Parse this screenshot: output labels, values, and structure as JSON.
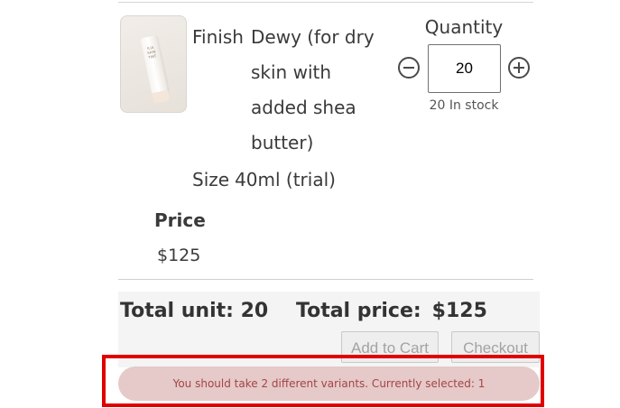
{
  "product": {
    "image_alt": "tube-icon",
    "tube_text": "ILIA SKIN TINT",
    "variant_label": "Finish",
    "variant_value": "Dewy (for dry skin with added shea butter)",
    "size_label": "Size",
    "size_value": "40ml (trial)"
  },
  "quantity": {
    "heading": "Quantity",
    "value": "20",
    "stock_note": "20 In stock"
  },
  "price": {
    "heading": "Price",
    "value": "$125"
  },
  "totals": {
    "units_text": "Total unit: 20",
    "price_label": "Total price:",
    "price_value": "$125"
  },
  "actions": {
    "add_to_cart": "Add to Cart",
    "checkout": "Checkout"
  },
  "alert": {
    "message": "You should take 2 different variants. Currently selected: 1"
  },
  "colors": {
    "alert_background": "#e6c9c9",
    "alert_text": "#a34545",
    "highlight_border": "#e00000",
    "disabled_button_text": "#a3a3a3"
  }
}
